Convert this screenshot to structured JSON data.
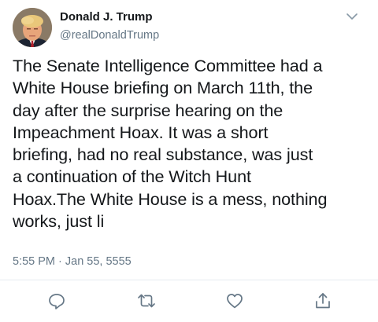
{
  "author": {
    "name": "Donald J. Trump",
    "handle": "@realDonaldTrump",
    "avatar_icon": "profile-photo"
  },
  "tweet": {
    "text": "The Senate Intelligence Committee had a\nWhite House briefing on March 11th, the\nday after the surprise hearing on the\nImpeachment Hoax. It was a short\nbriefing, had no real substance, was just\na continuation of the Witch Hunt\nHoax.The White House is a mess, nothing\nworks, just li",
    "timestamp": "5:55 PM · Jan 55, 5555"
  },
  "actions": {
    "reply_icon": "reply-icon",
    "retweet_icon": "retweet-icon",
    "like_icon": "heart-icon",
    "share_icon": "share-icon"
  },
  "colors": {
    "text": "#14171a",
    "secondary": "#657786",
    "icon": "#657786",
    "divider": "#e6ecf0"
  }
}
